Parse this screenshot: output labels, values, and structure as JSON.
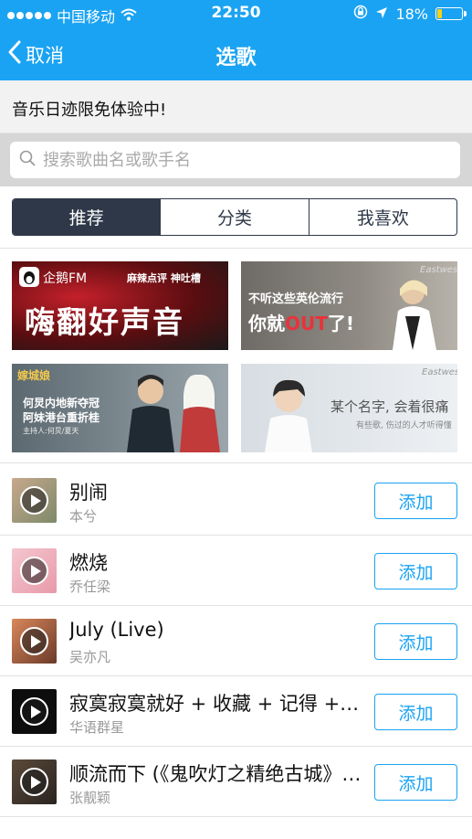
{
  "status_bar": {
    "carrier": "中国移动",
    "time": "22:50",
    "battery": "18%",
    "battery_level": 0.18
  },
  "nav": {
    "back_label": "取消",
    "title": "选歌"
  },
  "notice": "音乐日迹限免体验中!",
  "search": {
    "placeholder": "搜索歌曲名或歌手名"
  },
  "tabs": [
    {
      "label": "推荐",
      "active": true
    },
    {
      "label": "分类",
      "active": false
    },
    {
      "label": "我喜欢",
      "active": false
    }
  ],
  "banners": [
    {
      "brand": "企鹅FM",
      "tags": "麻辣点评  神吐槽",
      "headline": "嗨翻好声音"
    },
    {
      "brand": "Eastwest",
      "line1": "不听这些英伦流行",
      "line2a": "你就",
      "line2b": "OUT",
      "line2c": "了!"
    },
    {
      "brand": "嫁城娘",
      "line1": "何炅内地新夺冠",
      "line2": "阿妹港台重折桂",
      "line3": "主持人:何炅/夏天"
    },
    {
      "brand": "Eastwest",
      "line1": "某个名字, 会着很痛",
      "line2": "有些歌, 伤过的人才听得懂"
    }
  ],
  "songs": [
    {
      "title": "别闹",
      "artist": "本兮",
      "add_label": "添加"
    },
    {
      "title": "燃烧",
      "artist": "乔任梁",
      "add_label": "添加"
    },
    {
      "title": "July (Live)",
      "artist": "吴亦凡",
      "add_label": "添加"
    },
    {
      "title": "寂寞寂寞就好 + 收藏 + 记得 + 一千年以后",
      "artist": "华语群星",
      "add_label": "添加"
    },
    {
      "title": "顺流而下 (《鬼吹灯之精绝古城》插曲)",
      "artist": "张靓颖",
      "add_label": "添加"
    }
  ],
  "colors": {
    "brand_blue": "#1aa3f2",
    "segment_dark": "#2e3848"
  }
}
